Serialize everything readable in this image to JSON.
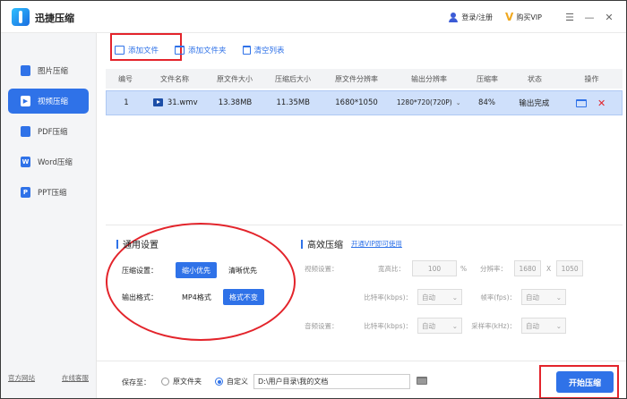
{
  "app": {
    "title": "迅捷压缩"
  },
  "titlebar": {
    "login": "登录/注册",
    "vip": "购买VIP",
    "menu": "☰",
    "min": "—",
    "close": "✕"
  },
  "sidebar": {
    "items": [
      {
        "label": "图片压缩",
        "icon": "image-icon"
      },
      {
        "label": "视频压缩",
        "icon": "video-icon",
        "active": true
      },
      {
        "label": "PDF压缩",
        "icon": "pdf-icon"
      },
      {
        "label": "Word压缩",
        "icon": "word-icon"
      },
      {
        "label": "PPT压缩",
        "icon": "ppt-icon"
      }
    ],
    "footer": {
      "site": "官方网站",
      "service": "在线客服"
    }
  },
  "toolbar": {
    "add_file": "添加文件",
    "add_folder": "添加文件夹",
    "clear_list": "清空列表"
  },
  "table": {
    "headers": [
      "编号",
      "文件名称",
      "原文件大小",
      "压缩后大小",
      "原文件分辨率",
      "输出分辨率",
      "压缩率",
      "状态",
      "操作"
    ],
    "rows": [
      {
        "num": "1",
        "name": "31.wmv",
        "orig_size": "13.38MB",
        "comp_size": "11.35MB",
        "orig_res": "1680*1050",
        "out_res": "1280*720(720P)",
        "rate": "84%",
        "status": "输出完成"
      }
    ]
  },
  "general": {
    "title": "通用设置",
    "compress_label": "压缩设置：",
    "compress_opts": [
      "缩小优先",
      "清晰优先"
    ],
    "output_label": "输出格式：",
    "output_opts": [
      "MP4格式",
      "格式不变"
    ]
  },
  "advanced": {
    "title": "高效压缩",
    "vip_link": "开通VIP即可使用",
    "video_label": "视频设置：",
    "aspect_label": "宽高比：",
    "aspect_value": "100",
    "percent": "%",
    "resolution_label": "分辨率：",
    "res_w": "1680",
    "res_x": "X",
    "res_h": "1050",
    "bitrate_label": "比特率(kbps)：",
    "bitrate_value": "自动",
    "framerate_label": "帧率(fps)：",
    "framerate_value": "自动",
    "audio_label": "音频设置：",
    "audio_bitrate_label": "比特率(kbps)：",
    "audio_bitrate_value": "自动",
    "sample_label": "采样率(kHz)：",
    "sample_value": "自动"
  },
  "bottom": {
    "save_to": "保存至：",
    "radio_orig": "原文件夹",
    "radio_custom": "自定义",
    "path": "D:\\用户目录\\我的文档",
    "start": "开始压缩"
  },
  "colors": {
    "accent": "#2f72e8",
    "highlight": "#e3242b",
    "row_selected": "#cfe0fb"
  }
}
